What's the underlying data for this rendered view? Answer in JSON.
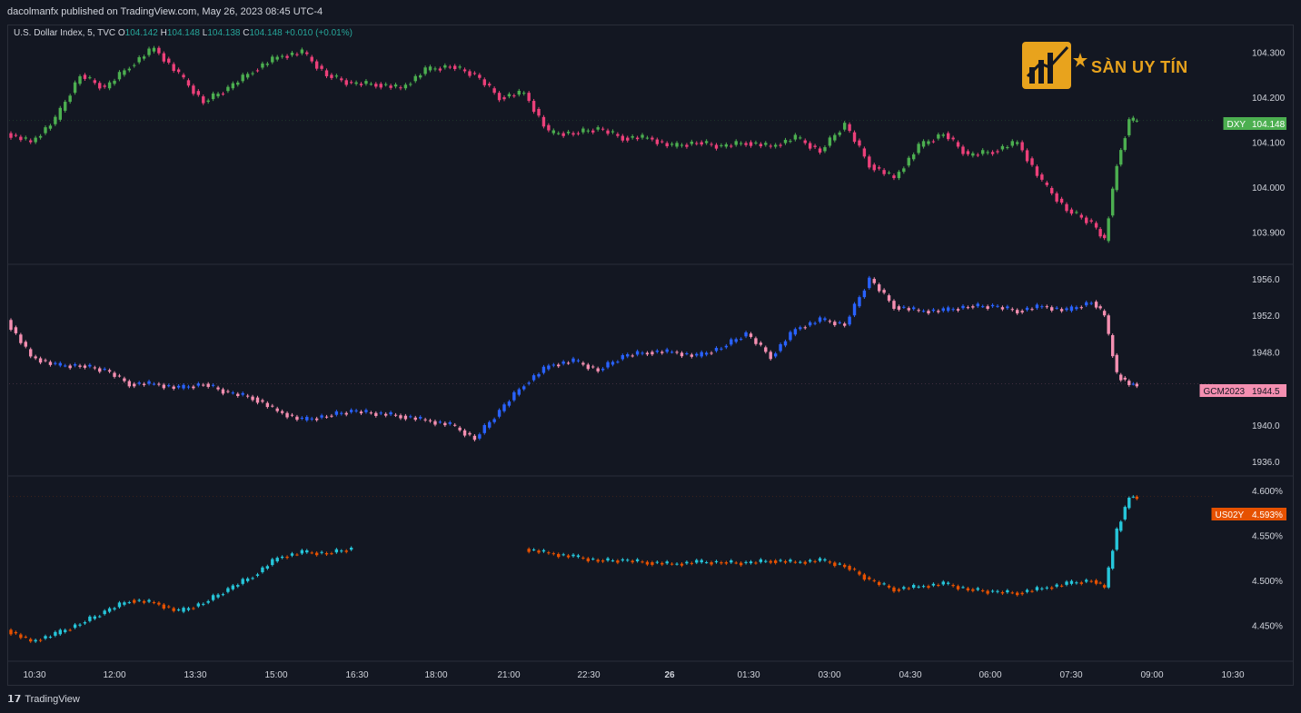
{
  "header": {
    "published": "dacolmanfx published on TradingView.com, May 26, 2023 08:45 UTC-4"
  },
  "legend": {
    "symbol": "U.S. Dollar Index, 5, TVC",
    "o_label": "O",
    "o": "104.142",
    "h_label": "H",
    "h": "104.148",
    "l_label": "L",
    "l": "104.138",
    "c_label": "C",
    "c": "104.148",
    "change": "+0.010 (+0.01%)"
  },
  "logo": {
    "text": "SÀN UY TÍN"
  },
  "footer": {
    "brand": "TradingView",
    "icon": "tradingview-logo-icon"
  },
  "colors": {
    "background": "#131722",
    "grid": "#2a2e39",
    "text": "#d1d4dc",
    "dxy_up": "#4caf50",
    "dxy_down": "#ec407a",
    "gold_up": "#2962ff",
    "gold_down": "#f48fb1",
    "us02y_up": "#26c6da",
    "us02y_down": "#e65100"
  },
  "chart_data": [
    {
      "type": "candlestick",
      "name": "DXY",
      "price_label": "104.148",
      "label_color": "#4caf50",
      "y_ticks": [
        "104.300",
        "104.200",
        "104.100",
        "104.000",
        "103.900"
      ],
      "ylim": [
        103.83,
        104.36
      ],
      "series": [
        {
          "x": "10:00",
          "y": 104.12
        },
        {
          "x": "10:30",
          "y": 104.1
        },
        {
          "x": "11:00",
          "y": 104.15
        },
        {
          "x": "11:30",
          "y": 104.25
        },
        {
          "x": "12:00",
          "y": 104.22
        },
        {
          "x": "12:30",
          "y": 104.27
        },
        {
          "x": "13:00",
          "y": 104.31
        },
        {
          "x": "13:30",
          "y": 104.25
        },
        {
          "x": "14:00",
          "y": 104.19
        },
        {
          "x": "14:30",
          "y": 104.22
        },
        {
          "x": "15:00",
          "y": 104.26
        },
        {
          "x": "15:30",
          "y": 104.29
        },
        {
          "x": "16:00",
          "y": 104.3
        },
        {
          "x": "16:30",
          "y": 104.25
        },
        {
          "x": "17:00",
          "y": 104.23
        },
        {
          "x": "17:30",
          "y": 104.23
        },
        {
          "x": "18:00",
          "y": 104.22
        },
        {
          "x": "18:30",
          "y": 104.26
        },
        {
          "x": "19:00",
          "y": 104.27
        },
        {
          "x": "19:30",
          "y": 104.25
        },
        {
          "x": "20:00",
          "y": 104.2
        },
        {
          "x": "20:30",
          "y": 104.21
        },
        {
          "x": "21:00",
          "y": 104.12
        },
        {
          "x": "21:30",
          "y": 104.12
        },
        {
          "x": "22:00",
          "y": 104.13
        },
        {
          "x": "22:30",
          "y": 104.11
        },
        {
          "x": "23:00",
          "y": 104.11
        },
        {
          "x": "23:30",
          "y": 104.09
        },
        {
          "x": "00:00",
          "y": 104.1
        },
        {
          "x": "00:30",
          "y": 104.09
        },
        {
          "x": "01:00",
          "y": 104.1
        },
        {
          "x": "01:30",
          "y": 104.09
        },
        {
          "x": "02:00",
          "y": 104.11
        },
        {
          "x": "02:30",
          "y": 104.08
        },
        {
          "x": "03:00",
          "y": 104.14
        },
        {
          "x": "03:30",
          "y": 104.05
        },
        {
          "x": "04:00",
          "y": 104.02
        },
        {
          "x": "04:30",
          "y": 104.09
        },
        {
          "x": "05:00",
          "y": 104.12
        },
        {
          "x": "05:30",
          "y": 104.07
        },
        {
          "x": "06:00",
          "y": 104.08
        },
        {
          "x": "06:30",
          "y": 104.1
        },
        {
          "x": "07:00",
          "y": 104.01
        },
        {
          "x": "07:30",
          "y": 103.95
        },
        {
          "x": "08:00",
          "y": 103.92
        },
        {
          "x": "08:15",
          "y": 103.88
        },
        {
          "x": "08:30",
          "y": 104.05
        },
        {
          "x": "08:45",
          "y": 104.148
        }
      ]
    },
    {
      "type": "candlestick",
      "name": "GCM2023",
      "price_label": "1944.5",
      "label_color": "#f48fb1",
      "y_ticks": [
        "1956.0",
        "1952.0",
        "1948.0",
        "1944.0",
        "1940.0",
        "1936.0"
      ],
      "ylim": [
        1934.5,
        1957.5
      ],
      "series": [
        {
          "x": "10:00",
          "y": 1951.5
        },
        {
          "x": "10:30",
          "y": 1947.5
        },
        {
          "x": "11:00",
          "y": 1946.5
        },
        {
          "x": "11:30",
          "y": 1946.5
        },
        {
          "x": "12:00",
          "y": 1946.0
        },
        {
          "x": "12:30",
          "y": 1944.5
        },
        {
          "x": "13:00",
          "y": 1944.5
        },
        {
          "x": "13:30",
          "y": 1944.0
        },
        {
          "x": "14:00",
          "y": 1944.5
        },
        {
          "x": "14:30",
          "y": 1943.5
        },
        {
          "x": "15:00",
          "y": 1943.0
        },
        {
          "x": "15:30",
          "y": 1941.5
        },
        {
          "x": "16:00",
          "y": 1940.5
        },
        {
          "x": "16:30",
          "y": 1941.0
        },
        {
          "x": "17:00",
          "y": 1941.5
        },
        {
          "x": "18:00",
          "y": 1941.0
        },
        {
          "x": "18:30",
          "y": 1940.5
        },
        {
          "x": "19:00",
          "y": 1940.0
        },
        {
          "x": "19:30",
          "y": 1938.5
        },
        {
          "x": "20:00",
          "y": 1941.5
        },
        {
          "x": "20:30",
          "y": 1944.5
        },
        {
          "x": "21:00",
          "y": 1946.5
        },
        {
          "x": "21:30",
          "y": 1947.0
        },
        {
          "x": "22:00",
          "y": 1946.0
        },
        {
          "x": "22:30",
          "y": 1947.5
        },
        {
          "x": "23:00",
          "y": 1948.0
        },
        {
          "x": "23:30",
          "y": 1948.0
        },
        {
          "x": "00:00",
          "y": 1947.5
        },
        {
          "x": "00:30",
          "y": 1948.5
        },
        {
          "x": "01:00",
          "y": 1950.0
        },
        {
          "x": "01:30",
          "y": 1947.5
        },
        {
          "x": "02:00",
          "y": 1950.5
        },
        {
          "x": "02:30",
          "y": 1951.5
        },
        {
          "x": "03:00",
          "y": 1951.0
        },
        {
          "x": "03:30",
          "y": 1956.0
        },
        {
          "x": "04:00",
          "y": 1953.0
        },
        {
          "x": "04:30",
          "y": 1952.5
        },
        {
          "x": "05:00",
          "y": 1952.5
        },
        {
          "x": "05:30",
          "y": 1953.0
        },
        {
          "x": "06:00",
          "y": 1953.0
        },
        {
          "x": "06:30",
          "y": 1952.5
        },
        {
          "x": "07:00",
          "y": 1953.0
        },
        {
          "x": "07:30",
          "y": 1952.5
        },
        {
          "x": "08:00",
          "y": 1953.5
        },
        {
          "x": "08:15",
          "y": 1952.0
        },
        {
          "x": "08:30",
          "y": 1945.5
        },
        {
          "x": "08:45",
          "y": 1944.5
        }
      ]
    },
    {
      "type": "candlestick",
      "name": "US02Y",
      "price_label": "4.593%",
      "label_color": "#e65100",
      "y_ticks": [
        "4.600%",
        "4.550%",
        "4.500%",
        "4.450%"
      ],
      "ylim": [
        4.41,
        4.615
      ],
      "series": [
        {
          "x": "10:00",
          "y": 4.445
        },
        {
          "x": "10:30",
          "y": 4.432
        },
        {
          "x": "11:00",
          "y": 4.44
        },
        {
          "x": "11:30",
          "y": 4.452
        },
        {
          "x": "12:00",
          "y": 4.465
        },
        {
          "x": "12:30",
          "y": 4.478
        },
        {
          "x": "13:00",
          "y": 4.475
        },
        {
          "x": "13:30",
          "y": 4.465
        },
        {
          "x": "14:00",
          "y": 4.475
        },
        {
          "x": "14:30",
          "y": 4.49
        },
        {
          "x": "15:00",
          "y": 4.505
        },
        {
          "x": "15:30",
          "y": 4.525
        },
        {
          "x": "16:00",
          "y": 4.531
        },
        {
          "x": "16:30",
          "y": 4.53
        },
        {
          "x": "17:00",
          "y": 4.535
        },
        {
          "x": "20:30",
          "y": 4.535
        },
        {
          "x": "21:00",
          "y": 4.53
        },
        {
          "x": "21:30",
          "y": 4.526
        },
        {
          "x": "22:00",
          "y": 4.522
        },
        {
          "x": "22:30",
          "y": 4.522
        },
        {
          "x": "23:00",
          "y": 4.52
        },
        {
          "x": "23:30",
          "y": 4.518
        },
        {
          "x": "00:00",
          "y": 4.52
        },
        {
          "x": "00:30",
          "y": 4.52
        },
        {
          "x": "01:00",
          "y": 4.519
        },
        {
          "x": "01:30",
          "y": 4.522
        },
        {
          "x": "02:00",
          "y": 4.52
        },
        {
          "x": "02:30",
          "y": 4.522
        },
        {
          "x": "03:00",
          "y": 4.516
        },
        {
          "x": "03:30",
          "y": 4.5
        },
        {
          "x": "04:00",
          "y": 4.49
        },
        {
          "x": "04:30",
          "y": 4.493
        },
        {
          "x": "05:00",
          "y": 4.496
        },
        {
          "x": "05:30",
          "y": 4.49
        },
        {
          "x": "06:00",
          "y": 4.487
        },
        {
          "x": "06:30",
          "y": 4.486
        },
        {
          "x": "07:00",
          "y": 4.491
        },
        {
          "x": "07:30",
          "y": 4.496
        },
        {
          "x": "08:00",
          "y": 4.5
        },
        {
          "x": "08:15",
          "y": 4.492
        },
        {
          "x": "08:30",
          "y": 4.555
        },
        {
          "x": "08:45",
          "y": 4.593
        }
      ]
    }
  ],
  "x_axis": {
    "ticks": [
      "10:30",
      "12:00",
      "13:30",
      "15:00",
      "16:30",
      "18:00",
      "21:00",
      "22:30",
      "26",
      "01:30",
      "03:00",
      "04:30",
      "06:00",
      "07:30",
      "09:00",
      "10:30"
    ]
  }
}
